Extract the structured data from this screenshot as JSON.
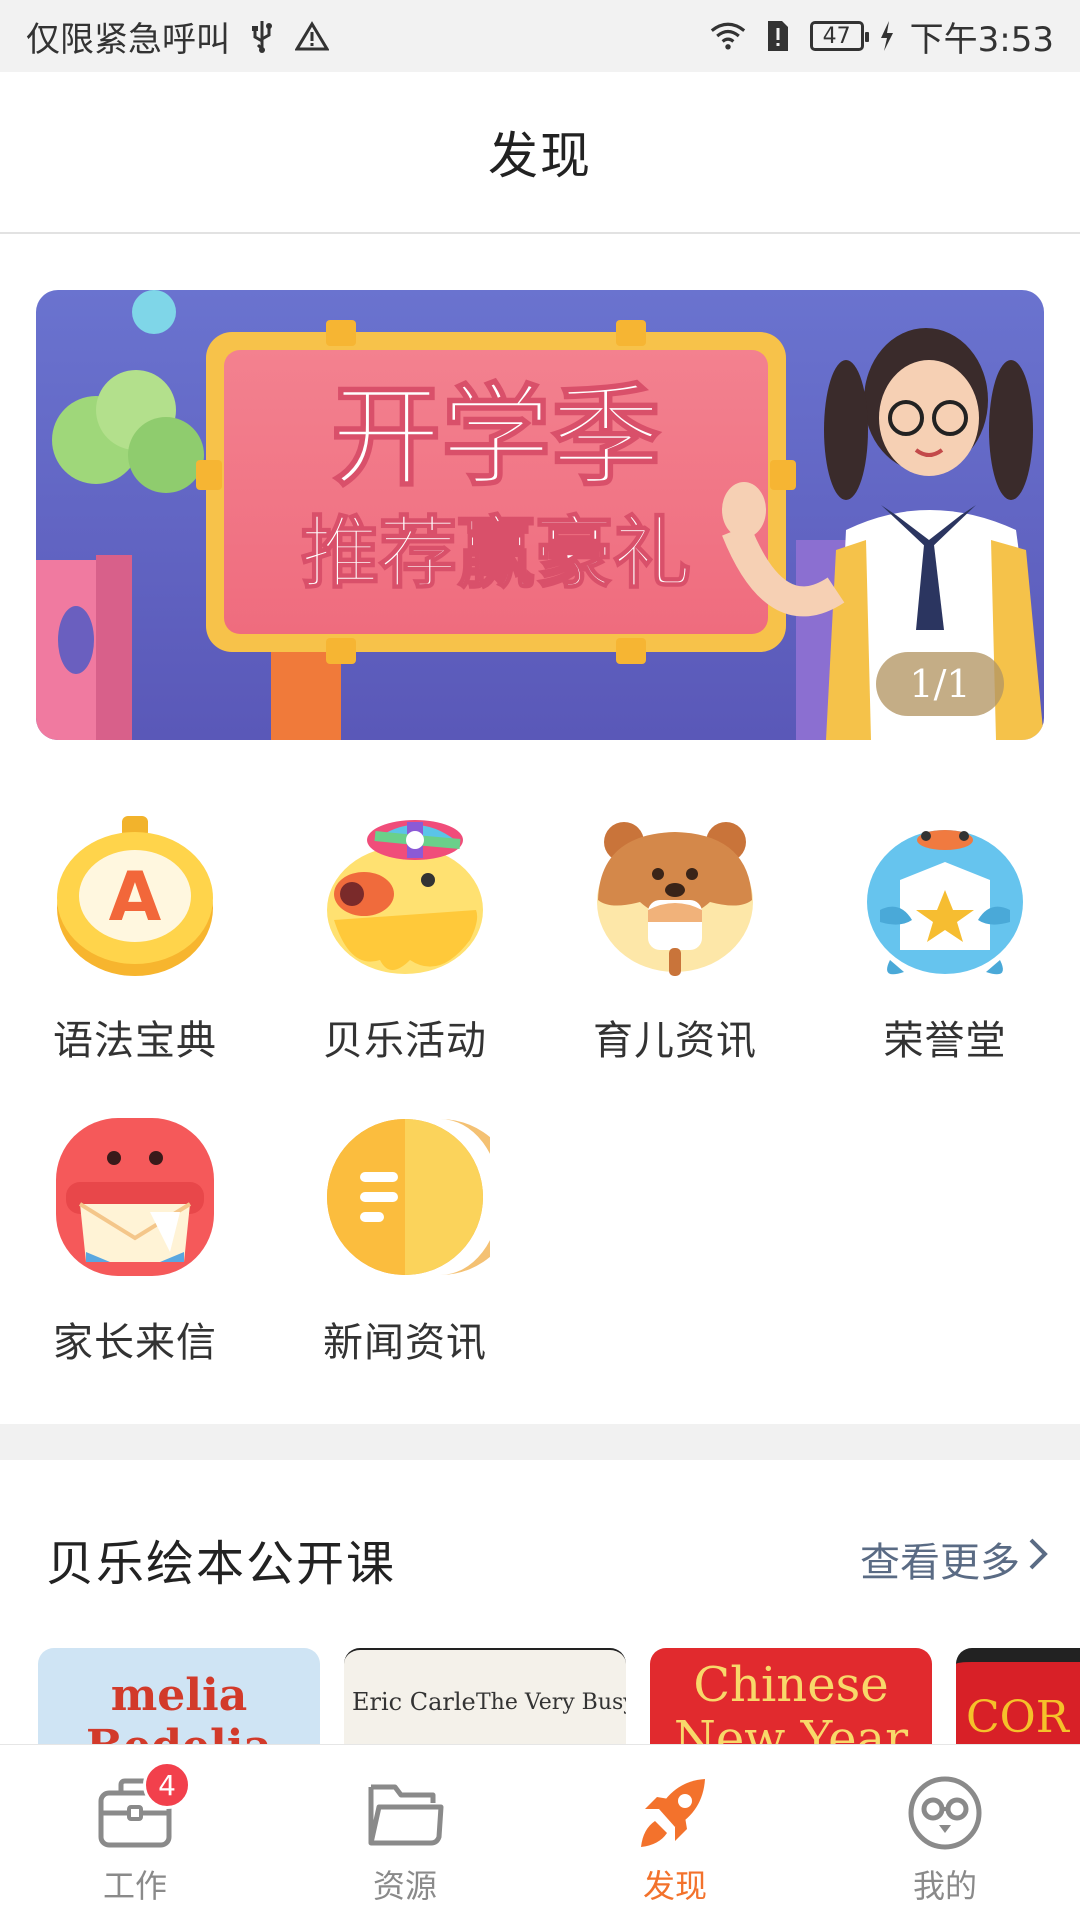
{
  "status_bar": {
    "carrier_text": "仅限紧急呼叫",
    "battery_level": "47",
    "time": "下午3:53"
  },
  "header": {
    "title": "发现"
  },
  "banner": {
    "headline": "开学季",
    "subline": "推荐赢豪礼",
    "counter": "1/1"
  },
  "features": [
    {
      "label": "语法宝典",
      "icon": "grammar-book-icon"
    },
    {
      "label": "贝乐活动",
      "icon": "activity-duck-icon"
    },
    {
      "label": "育儿资讯",
      "icon": "parenting-news-icon"
    },
    {
      "label": "荣誉堂",
      "icon": "honor-hall-icon"
    },
    {
      "label": "家长来信",
      "icon": "parent-letter-icon"
    },
    {
      "label": "新闻资讯",
      "icon": "news-icon"
    }
  ],
  "section": {
    "title": "贝乐绘本公开课",
    "more": "查看更多"
  },
  "books": [
    {
      "title": "melia Bedelia"
    },
    {
      "author": "Eric Carle",
      "title": "The Very Busy Spid"
    },
    {
      "title": "Chinese New Year"
    },
    {
      "title": "COR"
    }
  ],
  "tabbar": {
    "tabs": [
      {
        "label": "工作",
        "badge": "4"
      },
      {
        "label": "资源"
      },
      {
        "label": "发现"
      },
      {
        "label": "我的"
      }
    ],
    "active_color": "#f3722c",
    "inactive_color": "#8a8a8a"
  }
}
